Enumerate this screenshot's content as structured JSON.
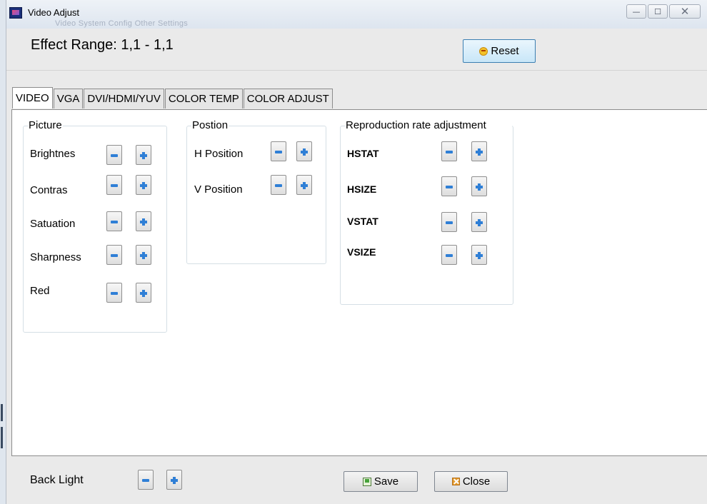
{
  "window": {
    "title": "Video Adjust",
    "ghost_text": "Video    System Config    Other Settings",
    "min_glyph": "—",
    "max_glyph": "☐",
    "close_glyph": "✕"
  },
  "header": {
    "effect_range": "Effect Range: 1,1 - 1,1",
    "reset_label": "Reset"
  },
  "tabs": [
    {
      "label": "VIDEO",
      "active": true
    },
    {
      "label": "VGA",
      "active": false
    },
    {
      "label": "DVI/HDMI/YUV",
      "active": false
    },
    {
      "label": "COLOR TEMP",
      "active": false
    },
    {
      "label": "COLOR ADJUST",
      "active": false
    }
  ],
  "groups": {
    "picture": {
      "title": "Picture",
      "items": [
        "Brightnes",
        "Contras",
        "Satuation",
        "Sharpness",
        "Red"
      ]
    },
    "position": {
      "title": "Postion",
      "items": [
        "H Position",
        "V Position"
      ]
    },
    "reproduction": {
      "title": "Reproduction rate adjustment",
      "items": [
        "HSTAT",
        "HSIZE",
        "VSTAT",
        "VSIZE"
      ]
    }
  },
  "footer": {
    "back_light_label": "Back Light",
    "save_label": "Save",
    "close_label": "Close"
  },
  "icons": {
    "minus": "minus-icon",
    "plus": "plus-icon",
    "reset": "smiley-icon",
    "save": "save-icon",
    "close": "close-icon"
  },
  "colors": {
    "accent_blue": "#2f7fd6",
    "panel_bg": "#ffffff",
    "window_bg": "#eaeaea"
  }
}
